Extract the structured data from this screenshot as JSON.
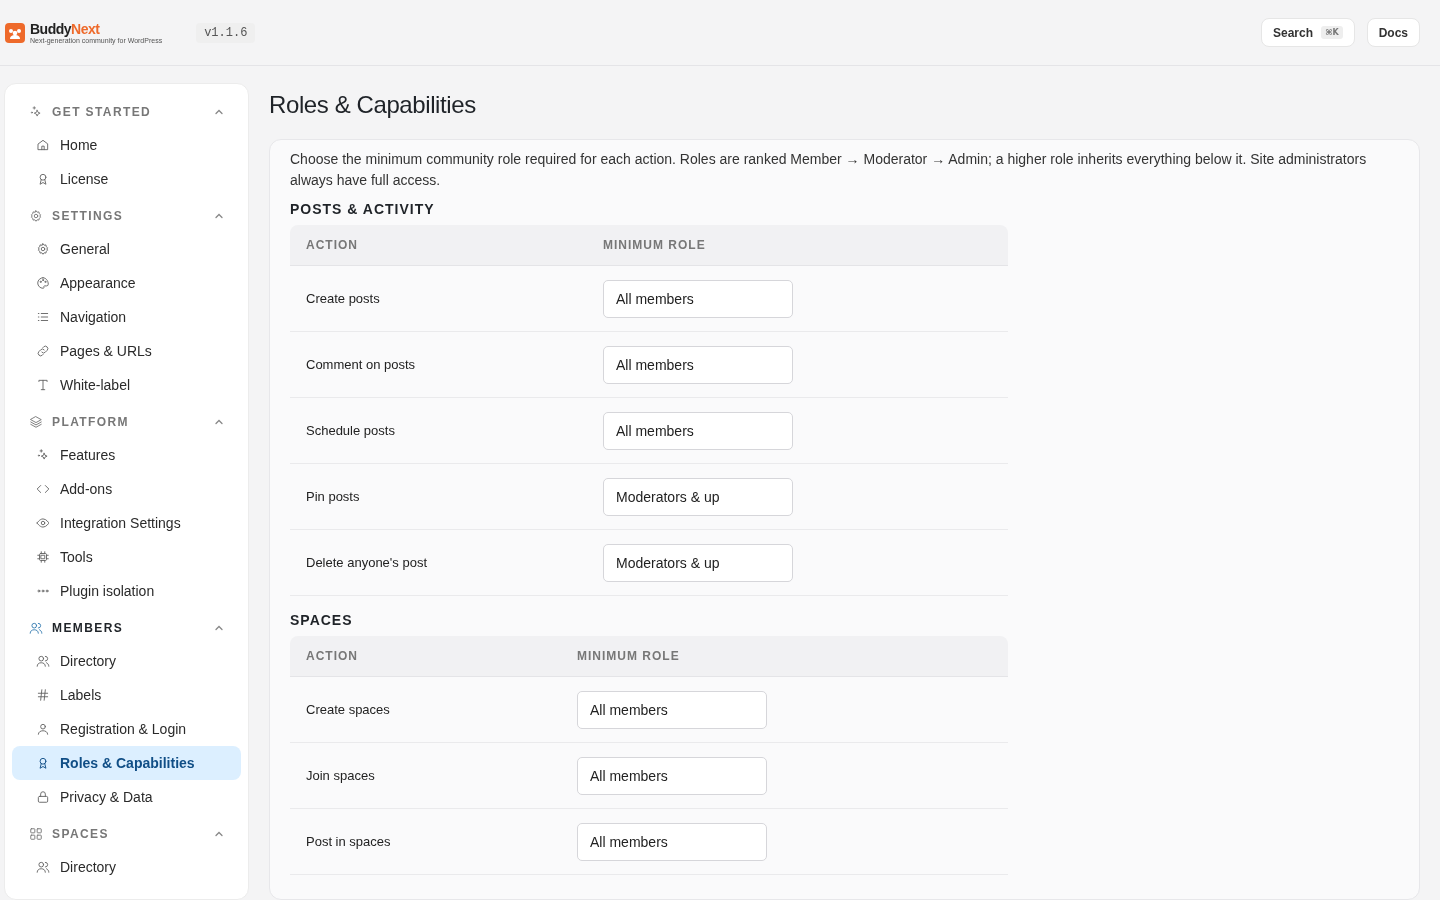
{
  "header": {
    "brand": "BuddyNext",
    "tagline": "Next-generation community for WordPress",
    "version": "v1.1.6",
    "search": {
      "label": "Search",
      "shortcut": "⌘K"
    },
    "docs": "Docs"
  },
  "sidebar": {
    "groups": [
      {
        "label": "GET STARTED",
        "kind": "sparkle",
        "active": false,
        "expanded": true,
        "items": [
          {
            "label": "Home",
            "kind": "home",
            "selected": false
          },
          {
            "label": "License",
            "kind": "award",
            "selected": false
          }
        ]
      },
      {
        "label": "SETTINGS",
        "kind": "gear",
        "active": false,
        "expanded": true,
        "items": [
          {
            "label": "General",
            "kind": "gear",
            "selected": false
          },
          {
            "label": "Appearance",
            "kind": "palette",
            "selected": false
          },
          {
            "label": "Navigation",
            "kind": "list",
            "selected": false
          },
          {
            "label": "Pages & URLs",
            "kind": "link",
            "selected": false
          },
          {
            "label": "White-label",
            "kind": "type",
            "selected": false
          }
        ]
      },
      {
        "label": "PLATFORM",
        "kind": "layers",
        "active": false,
        "expanded": true,
        "items": [
          {
            "label": "Features",
            "kind": "sparkle",
            "selected": false
          },
          {
            "label": "Add-ons",
            "kind": "code",
            "selected": false
          },
          {
            "label": "Integration Settings",
            "kind": "eye",
            "selected": false
          },
          {
            "label": "Tools",
            "kind": "chip",
            "selected": false
          },
          {
            "label": "Plugin isolation",
            "kind": "dots",
            "selected": false
          }
        ]
      },
      {
        "label": "MEMBERS",
        "kind": "users",
        "active": true,
        "expanded": true,
        "items": [
          {
            "label": "Directory",
            "kind": "users",
            "selected": false
          },
          {
            "label": "Labels",
            "kind": "hash",
            "selected": false
          },
          {
            "label": "Registration & Login",
            "kind": "user",
            "selected": false
          },
          {
            "label": "Roles & Capabilities",
            "kind": "award",
            "selected": true
          },
          {
            "label": "Privacy & Data",
            "kind": "lock",
            "selected": false
          }
        ]
      },
      {
        "label": "SPACES",
        "kind": "grid",
        "active": false,
        "expanded": true,
        "items": [
          {
            "label": "Directory",
            "kind": "users",
            "selected": false
          }
        ]
      }
    ]
  },
  "page": {
    "title": "Roles & Capabilities",
    "intro": "Choose the minimum community role required for each action. Roles are ranked Member → Moderator → Admin; a higher role inherits everything below it. Site administrators always have full access.",
    "sections": [
      {
        "title": "POSTS & ACTIVITY",
        "columns": [
          "ACTION",
          "MINIMUM ROLE"
        ],
        "rows": [
          {
            "action": "Create posts",
            "role": "All members"
          },
          {
            "action": "Comment on posts",
            "role": "All members"
          },
          {
            "action": "Schedule posts",
            "role": "All members"
          },
          {
            "action": "Pin posts",
            "role": "Moderators & up"
          },
          {
            "action": "Delete anyone's post",
            "role": "Moderators & up"
          }
        ]
      },
      {
        "title": "SPACES",
        "columns": [
          "ACTION",
          "MINIMUM ROLE"
        ],
        "rows": [
          {
            "action": "Create spaces",
            "role": "All members"
          },
          {
            "action": "Join spaces",
            "role": "All members"
          },
          {
            "action": "Post in spaces",
            "role": "All members"
          }
        ]
      }
    ]
  }
}
